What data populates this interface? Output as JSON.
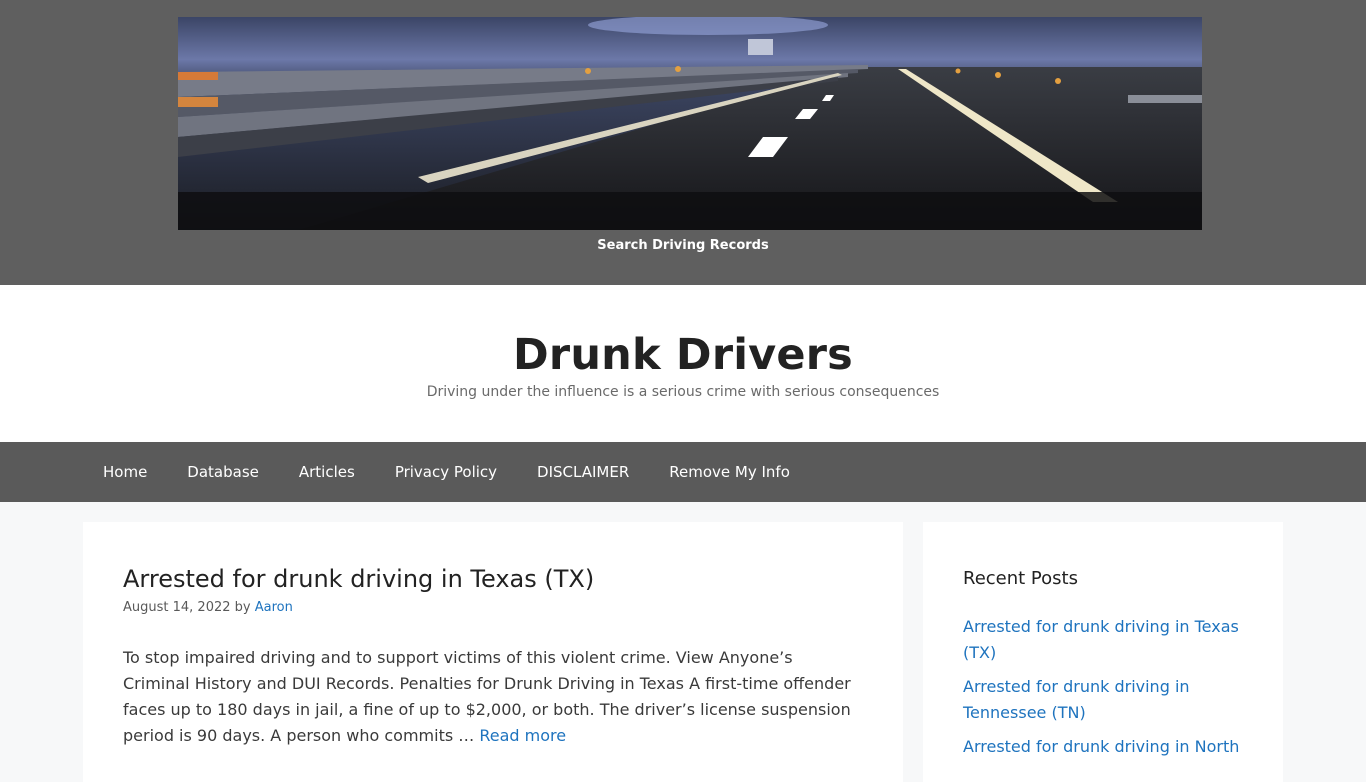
{
  "banner": {
    "caption": "Search Driving Records"
  },
  "site": {
    "title": "Drunk Drivers",
    "tagline": "Driving under the influence is a serious crime with serious consequences"
  },
  "nav": {
    "items": [
      {
        "label": "Home"
      },
      {
        "label": "Database"
      },
      {
        "label": "Articles"
      },
      {
        "label": "Privacy Policy"
      },
      {
        "label": "DISCLAIMER"
      },
      {
        "label": "Remove My Info"
      }
    ]
  },
  "post": {
    "title": "Arrested for drunk driving in Texas (TX)",
    "date": "August 14, 2022",
    "by": "by",
    "author": "Aaron",
    "excerpt": "To stop impaired driving and to support victims of this violent crime. View Anyone’s Criminal History and DUI Records. Penalties for Drunk Driving in Texas A first-time offender faces up to 180 days in jail, a fine of up to $2,000, or both. The driver’s license suspension period is 90 days. A person who commits …",
    "read_more": "Read more"
  },
  "sidebar": {
    "widget_title": "Recent Posts",
    "recent_posts": [
      {
        "title": "Arrested for drunk driving in Texas (TX)"
      },
      {
        "title": "Arrested for drunk driving in Tennessee (TN)"
      },
      {
        "title": "Arrested for drunk driving in North"
      }
    ]
  },
  "colors": {
    "banner_bg": "#5f5f5f",
    "nav_bg": "#5a5a5a",
    "link": "#1e73be",
    "page_bg": "#f7f8f9"
  }
}
